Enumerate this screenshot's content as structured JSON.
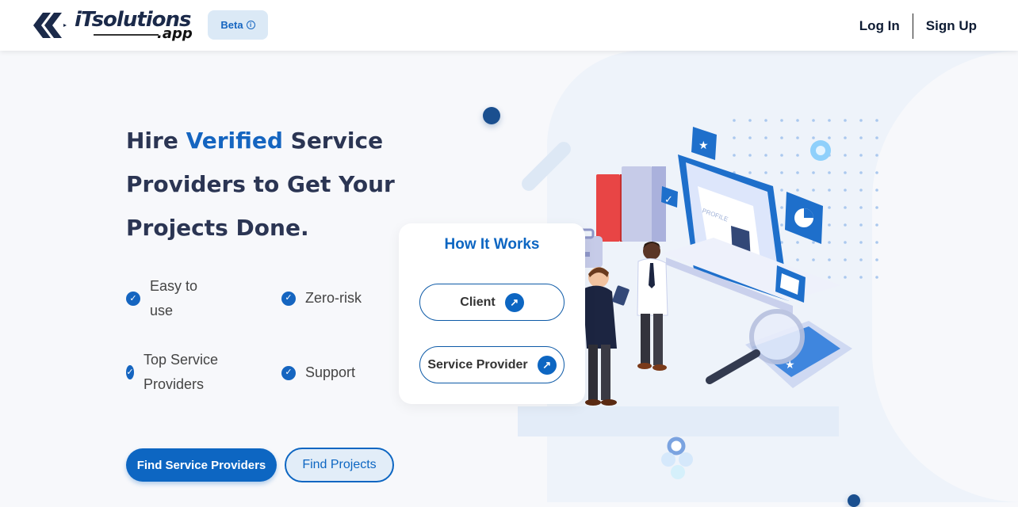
{
  "header": {
    "logo_main": "iTsolutions",
    "logo_sub": ".app",
    "beta_label": "Beta",
    "login_label": "Log In",
    "signup_label": "Sign Up"
  },
  "hero": {
    "title_part1": "Hire ",
    "title_highlight": "Verified",
    "title_part2": " Service Providers to Get Your Projects Done.",
    "features": [
      {
        "label": "Easy to use"
      },
      {
        "label": "Zero-risk"
      },
      {
        "label": "Top Service Providers"
      },
      {
        "label": "Support"
      }
    ],
    "primary_button": "Find Service Providers",
    "secondary_button": "Find Projects"
  },
  "how_it_works": {
    "title": "How It Works",
    "client_label": "Client",
    "provider_label": "Service Provider"
  },
  "illustration": {
    "profile_label": "PROFILE"
  },
  "colors": {
    "accent": "#0d66c2",
    "heading": "#2b3553",
    "beta_bg": "#dbe9f6"
  }
}
